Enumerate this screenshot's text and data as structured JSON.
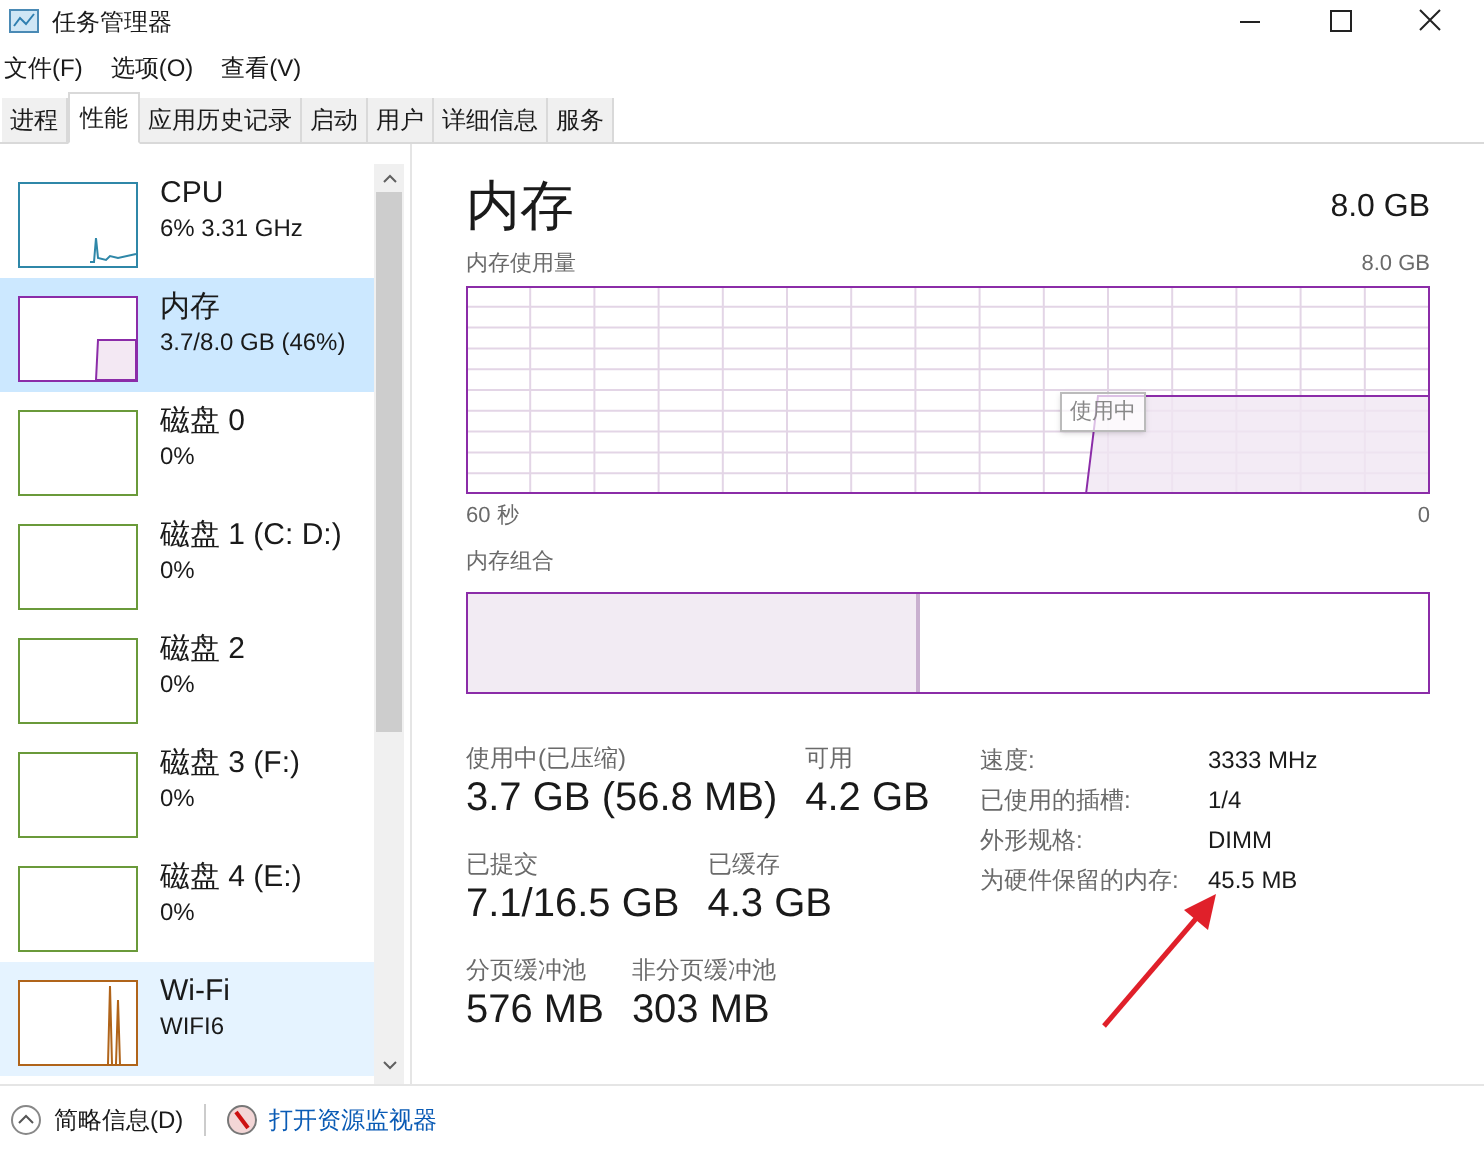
{
  "window": {
    "title": "任务管理器"
  },
  "menu": [
    "文件(F)",
    "选项(O)",
    "查看(V)"
  ],
  "tabs": [
    {
      "label": "进程",
      "selected": false
    },
    {
      "label": "性能",
      "selected": true
    },
    {
      "label": "应用历史记录",
      "selected": false
    },
    {
      "label": "启动",
      "selected": false
    },
    {
      "label": "用户",
      "selected": false
    },
    {
      "label": "详细信息",
      "selected": false
    },
    {
      "label": "服务",
      "selected": false
    }
  ],
  "sidebar": {
    "items": [
      {
        "kind": "cpu",
        "name": "CPU",
        "detail": "6% 3.31 GHz",
        "color": "#2f87a8",
        "selected": false,
        "hovered": false
      },
      {
        "kind": "memory",
        "name": "内存",
        "detail": "3.7/8.0 GB (46%)",
        "color": "#8b2ca8",
        "selected": true,
        "hovered": false
      },
      {
        "kind": "disk",
        "name": "磁盘 0",
        "detail": "0%",
        "color": "#6a9a3a",
        "selected": false,
        "hovered": false
      },
      {
        "kind": "disk",
        "name": "磁盘 1 (C: D:)",
        "detail": "0%",
        "color": "#6a9a3a",
        "selected": false,
        "hovered": false
      },
      {
        "kind": "disk",
        "name": "磁盘 2",
        "detail": "0%",
        "color": "#6a9a3a",
        "selected": false,
        "hovered": false
      },
      {
        "kind": "disk",
        "name": "磁盘 3 (F:)",
        "detail": "0%",
        "color": "#6a9a3a",
        "selected": false,
        "hovered": false
      },
      {
        "kind": "disk",
        "name": "磁盘 4 (E:)",
        "detail": "0%",
        "color": "#6a9a3a",
        "selected": false,
        "hovered": false
      },
      {
        "kind": "network",
        "name": "Wi-Fi",
        "detail": "WIFI6",
        "color": "#b0641a",
        "selected": false,
        "hovered": true
      }
    ]
  },
  "detail": {
    "title": "内存",
    "total": "8.0 GB",
    "usage_graph": {
      "label": "内存使用量",
      "max": "8.0 GB",
      "tooltip": "使用中",
      "time_start": "60 秒",
      "time_end": "0"
    },
    "composition": {
      "label": "内存组合",
      "level": 0.47
    },
    "stats": [
      [
        {
          "label": "使用中(已压缩)",
          "value": "3.7 GB (56.8 MB)"
        },
        {
          "label": "可用",
          "value": "4.2 GB"
        }
      ],
      [
        {
          "label": "已提交",
          "value": "7.1/16.5 GB"
        },
        {
          "label": "已缓存",
          "value": "4.3 GB"
        }
      ],
      [
        {
          "label": "分页缓冲池",
          "value": "576 MB"
        },
        {
          "label": "非分页缓冲池",
          "value": "303 MB"
        }
      ]
    ],
    "specs": [
      {
        "label": "速度:",
        "value": "3333 MHz"
      },
      {
        "label": "已使用的插槽:",
        "value": "1/4"
      },
      {
        "label": "外形规格:",
        "value": "DIMM"
      },
      {
        "label": "为硬件保留的内存:",
        "value": "45.5 MB"
      }
    ]
  },
  "footer": {
    "summary": "简略信息(D)",
    "resource_monitor": "打开资源监视器"
  }
}
